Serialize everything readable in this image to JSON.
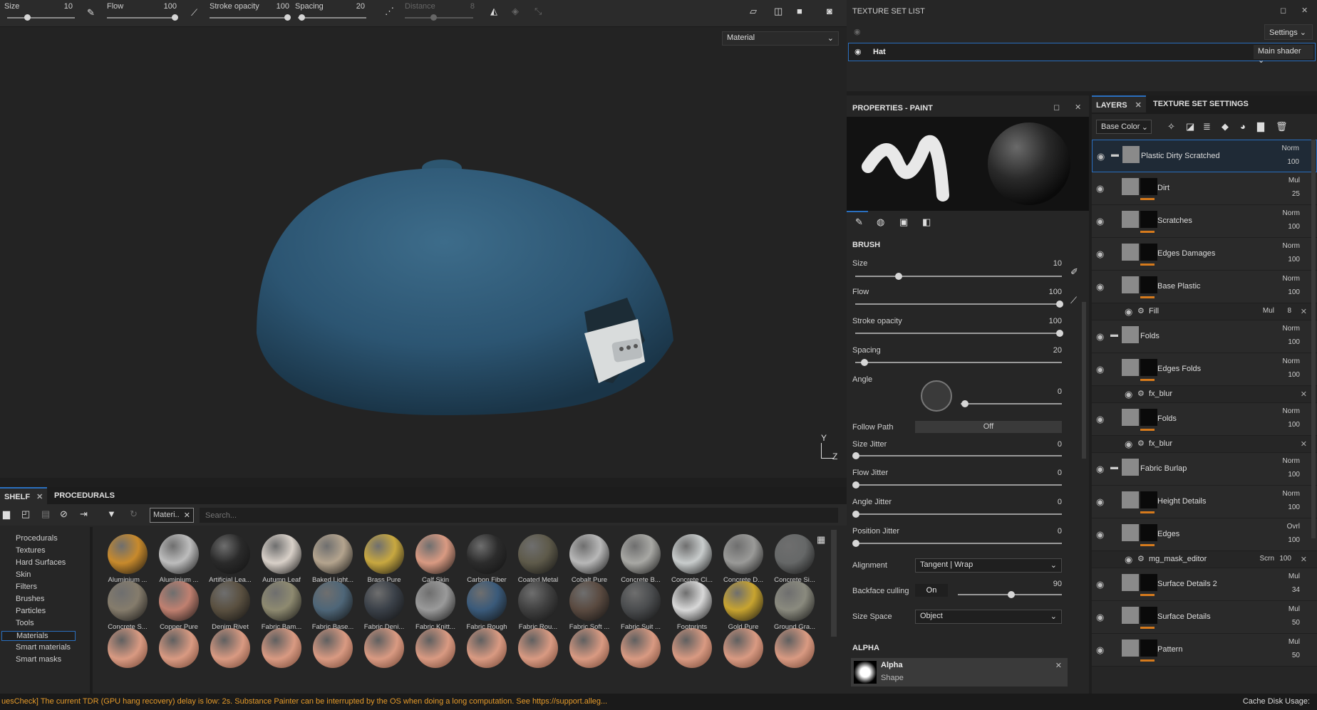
{
  "toolbar": {
    "size_label": "Size",
    "size_value": "10",
    "size_fill": 0.4,
    "flow_label": "Flow",
    "flow_value": "100",
    "flow_fill": 1.0,
    "stroke_label": "Stroke opacity",
    "stroke_value": "100",
    "stroke_fill": 1.0,
    "spacing_label": "Spacing",
    "spacing_value": "20",
    "spacing_fill": 0.1,
    "distance_label": "Distance",
    "distance_value": "8",
    "distance_fill": 0.5
  },
  "viewport": {
    "mode_select": "Material",
    "axis_y": "Y",
    "axis_z": "Z"
  },
  "shelf": {
    "tabs": [
      "SHELF",
      "PROCEDURALS"
    ],
    "filter_chip": "Materi..",
    "search_placeholder": "Search...",
    "categories": [
      "Procedurals",
      "Textures",
      "Hard Surfaces",
      "Skin",
      "Filters",
      "Brushes",
      "Particles",
      "Tools",
      "Materials",
      "Smart materials",
      "Smart masks"
    ],
    "selected_category": "Materials",
    "materials": [
      {
        "name": "Aluminium ...",
        "color": "#c88a2c"
      },
      {
        "name": "Aluminium ...",
        "color": "#bdbdbd"
      },
      {
        "name": "Artificial Lea...",
        "color": "#2a2a2a"
      },
      {
        "name": "Autumn Leaf",
        "color": "#d8d0c8"
      },
      {
        "name": "Baked Light...",
        "color": "#b4a48e"
      },
      {
        "name": "Brass Pure",
        "color": "#c8a840"
      },
      {
        "name": "Calf Skin",
        "color": "#d99a82"
      },
      {
        "name": "Carbon Fiber",
        "color": "#2c2c2c"
      },
      {
        "name": "Coated Metal",
        "color": "#5e5a4a"
      },
      {
        "name": "Cobalt Pure",
        "color": "#b8b8b8"
      },
      {
        "name": "Concrete B...",
        "color": "#a8a8a4"
      },
      {
        "name": "Concrete Cl...",
        "color": "#c8cccc"
      },
      {
        "name": "Concrete D...",
        "color": "#9a9a98"
      },
      {
        "name": "Concrete Si...",
        "color": "#666868"
      },
      {
        "name": "Concrete S...",
        "color": "#857c6c"
      },
      {
        "name": "Copper Pure",
        "color": "#c08070"
      },
      {
        "name": "Denim Rivet",
        "color": "#5a5040"
      },
      {
        "name": "Fabric Bam...",
        "color": "#8e8a70"
      },
      {
        "name": "Fabric Base...",
        "color": "#4e6678"
      },
      {
        "name": "Fabric Deni...",
        "color": "#3a4048"
      },
      {
        "name": "Fabric Knitt...",
        "color": "#9a9a9a"
      },
      {
        "name": "Fabric Rough",
        "color": "#3a5a7a"
      },
      {
        "name": "Fabric Rou...",
        "color": "#404040"
      },
      {
        "name": "Fabric Soft ...",
        "color": "#5a4a40"
      },
      {
        "name": "Fabric Suit ...",
        "color": "#4a4c4e"
      },
      {
        "name": "Footprints",
        "color": "#d8d8d8"
      },
      {
        "name": "Gold Pure",
        "color": "#c8a430"
      },
      {
        "name": "Ground Gra...",
        "color": "#8a8a7e"
      }
    ],
    "skin_color": "#d99a82"
  },
  "status": {
    "message": "uesCheck] The current TDR (GPU hang recovery) delay is low: 2s. Substance Painter can be interrupted by the OS when doing a long computation. See https://support.alleg...",
    "cache": "Cache Disk Usage:"
  },
  "texture_set_list": {
    "title": "TEXTURE SET LIST",
    "settings_btn": "Settings",
    "set_name": "Hat",
    "shader": "Main shader"
  },
  "properties": {
    "title": "PROPERTIES - PAINT",
    "brush_header": "BRUSH",
    "size_label": "Size",
    "size_value": "10",
    "size_fill": 0.4,
    "flow_label": "Flow",
    "flow_value": "100",
    "flow_fill": 1.0,
    "stroke_label": "Stroke opacity",
    "stroke_value": "100",
    "stroke_fill": 1.0,
    "spacing_label": "Spacing",
    "spacing_value": "20",
    "spacing_fill": 0.04,
    "angle_label": "Angle",
    "angle_value": "0",
    "follow_label": "Follow Path",
    "follow_value": "Off",
    "size_jitter_label": "Size Jitter",
    "size_jitter_value": "0",
    "flow_jitter_label": "Flow Jitter",
    "flow_jitter_value": "0",
    "angle_jitter_label": "Angle Jitter",
    "angle_jitter_value": "0",
    "pos_jitter_label": "Position Jitter",
    "pos_jitter_value": "0",
    "alignment_label": "Alignment",
    "alignment_value": "Tangent | Wrap",
    "backface_label": "Backface culling",
    "backface_toggle": "On",
    "backface_value": "90",
    "backface_fill": 0.5,
    "size_space_label": "Size Space",
    "size_space_value": "Object",
    "alpha_header": "ALPHA",
    "alpha_name": "Alpha",
    "alpha_sub": "Shape"
  },
  "layers": {
    "tabs": [
      "LAYERS",
      "TEXTURE SET SETTINGS"
    ],
    "channel": "Base Color",
    "items": [
      {
        "name": "Plastic Dirty Scratched",
        "blend": "Norm",
        "opacity": "100",
        "folder": true,
        "sub": false,
        "selected": true
      },
      {
        "name": "Dirt",
        "blend": "Mul",
        "opacity": "25",
        "folder": false,
        "sub": false
      },
      {
        "name": "Scratches",
        "blend": "Norm",
        "opacity": "100",
        "folder": false,
        "sub": false
      },
      {
        "name": "Edges Damages",
        "blend": "Norm",
        "opacity": "100",
        "folder": false,
        "sub": false
      },
      {
        "name": "Base Plastic",
        "blend": "Norm",
        "opacity": "100",
        "folder": false,
        "sub": false
      },
      {
        "name": "Fill",
        "blend": "Mul",
        "opacity": "8",
        "folder": false,
        "sub": true
      },
      {
        "name": "Folds",
        "blend": "Norm",
        "opacity": "100",
        "folder": true,
        "sub": false
      },
      {
        "name": "Edges Folds",
        "blend": "Norm",
        "opacity": "100",
        "folder": false,
        "sub": false
      },
      {
        "name": "fx_blur",
        "blend": "",
        "opacity": "",
        "folder": false,
        "sub": true
      },
      {
        "name": "Folds",
        "blend": "Norm",
        "opacity": "100",
        "folder": false,
        "sub": false
      },
      {
        "name": "fx_blur",
        "blend": "",
        "opacity": "",
        "folder": false,
        "sub": true
      },
      {
        "name": "Fabric Burlap",
        "blend": "Norm",
        "opacity": "100",
        "folder": true,
        "sub": false
      },
      {
        "name": "Height Details",
        "blend": "Norm",
        "opacity": "100",
        "folder": false,
        "sub": false
      },
      {
        "name": "Edges",
        "blend": "Ovrl",
        "opacity": "100",
        "folder": false,
        "sub": false
      },
      {
        "name": "mg_mask_editor",
        "blend": "Scrn",
        "opacity": "100",
        "folder": false,
        "sub": true
      },
      {
        "name": "Surface Details 2",
        "blend": "Mul",
        "opacity": "34",
        "folder": false,
        "sub": false
      },
      {
        "name": "Surface Details",
        "blend": "Mul",
        "opacity": "50",
        "folder": false,
        "sub": false
      },
      {
        "name": "Pattern",
        "blend": "Mul",
        "opacity": "50",
        "folder": false,
        "sub": false
      }
    ]
  }
}
